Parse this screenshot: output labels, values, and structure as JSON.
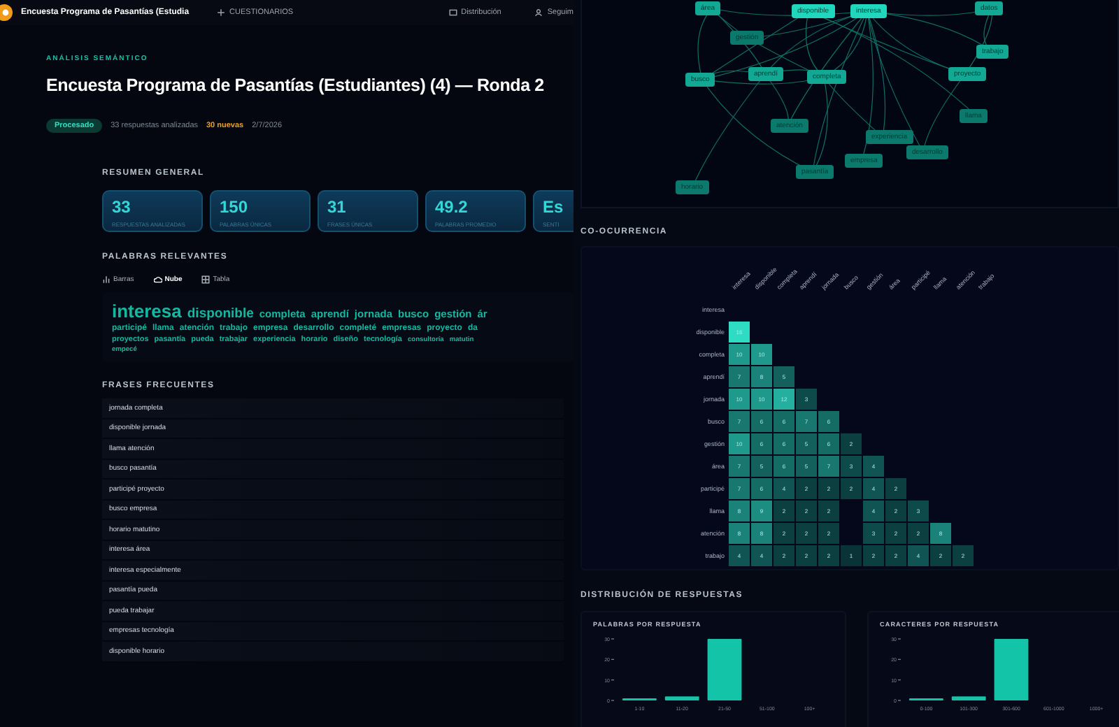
{
  "topbar": {
    "title": "Encuesta Programa de Pasantías (Estudia",
    "nav": [
      "CUESTIONARIOS",
      "Distribución",
      "Seguim"
    ]
  },
  "header": {
    "eyebrow": "ANÁLISIS SEMÁNTICO",
    "title": "Encuesta Programa de Pasantías (Estudiantes) (4) — Ronda 2",
    "status": "Procesado",
    "analyzed": "33 respuestas analizadas",
    "new": "30 nuevas",
    "date": "2/7/2026"
  },
  "summary": {
    "title": "RESUMEN GENERAL",
    "cards": [
      {
        "value": "33",
        "label": "RESPUESTAS ANALIZADAS"
      },
      {
        "value": "150",
        "label": "PALABRAS ÚNICAS"
      },
      {
        "value": "31",
        "label": "FRASES ÚNICAS"
      },
      {
        "value": "49.2",
        "label": "PALABRAS PROMEDIO"
      },
      {
        "value": "Es",
        "label": "SENTI"
      }
    ]
  },
  "keywords": {
    "title": "PALABRAS RELEVANTES",
    "tabs": [
      {
        "label": "Barras",
        "selected": false
      },
      {
        "label": "Nube",
        "selected": true
      },
      {
        "label": "Tabla",
        "selected": false
      }
    ],
    "cloud_lines": [
      [
        {
          "text": "interesa",
          "kind": "xl"
        },
        {
          "text": "disponible",
          "kind": "lg"
        },
        {
          "text": "completa",
          "kind": "md"
        },
        {
          "text": "aprendí",
          "kind": "md"
        },
        {
          "text": "jornada",
          "kind": "md"
        },
        {
          "text": "busco",
          "kind": "md"
        },
        {
          "text": "gestión",
          "kind": "md"
        },
        {
          "text": "ár",
          "kind": "md"
        }
      ],
      [
        {
          "text": "participé",
          "kind": "sm"
        },
        {
          "text": "llama",
          "kind": "sm"
        },
        {
          "text": "atención",
          "kind": "sm"
        },
        {
          "text": "trabajo",
          "kind": "sm"
        },
        {
          "text": "empresa",
          "kind": "sm"
        },
        {
          "text": "desarrollo",
          "kind": "sm"
        },
        {
          "text": "completé",
          "kind": "sm"
        },
        {
          "text": "empresas",
          "kind": "sm"
        },
        {
          "text": "proyecto",
          "kind": "sm"
        },
        {
          "text": "da",
          "kind": "sm"
        }
      ],
      [
        {
          "text": "proyectos",
          "kind": "xs"
        },
        {
          "text": "pasantía",
          "kind": "xs"
        },
        {
          "text": "pueda",
          "kind": "xs"
        },
        {
          "text": "trabajar",
          "kind": "xs"
        },
        {
          "text": "experiencia",
          "kind": "xs"
        },
        {
          "text": "horario",
          "kind": "xs"
        },
        {
          "text": "diseño",
          "kind": "xs"
        },
        {
          "text": "tecnología",
          "kind": "xs"
        },
        {
          "text": "consultoría",
          "kind": "xxs"
        },
        {
          "text": "matutin",
          "kind": "xxs"
        }
      ],
      [
        {
          "text": "empecé",
          "kind": "xxs"
        }
      ]
    ]
  },
  "phrases": {
    "title": "FRASES FRECUENTES",
    "items": [
      "jornada completa",
      "disponible jornada",
      "llama atención",
      "busco pasantía",
      "participé proyecto",
      "busco empresa",
      "horario matutino",
      "interesa área",
      "interesa especialmente",
      "pasantía pueda",
      "pueda trabajar",
      "empresas tecnología",
      "disponible horario"
    ]
  },
  "network": {
    "nodes": [
      {
        "label": "área",
        "kind": "mid"
      },
      {
        "label": "disponible",
        "kind": "hub"
      },
      {
        "label": "interesa",
        "kind": "hub"
      },
      {
        "label": "datos",
        "kind": "mid"
      },
      {
        "label": "gestión",
        "kind": "minor"
      },
      {
        "label": "trabajo",
        "kind": "mid"
      },
      {
        "label": "busco",
        "kind": "mid"
      },
      {
        "label": "aprendí",
        "kind": "mid"
      },
      {
        "label": "completa",
        "kind": "mid"
      },
      {
        "label": "proyecto",
        "kind": "mid"
      },
      {
        "label": "llama",
        "kind": "minor"
      },
      {
        "label": "atención",
        "kind": "minor"
      },
      {
        "label": "experiencia",
        "kind": "minor"
      },
      {
        "label": "desarrollo",
        "kind": "minor"
      },
      {
        "label": "empresa",
        "kind": "minor"
      },
      {
        "label": "pasantía",
        "kind": "minor"
      },
      {
        "label": "horario",
        "kind": "minor"
      }
    ]
  },
  "cooccurrence": {
    "title": "CO-OCURRENCIA",
    "columns": [
      "interesa",
      "disponible",
      "completa",
      "aprendí",
      "jornada",
      "busco",
      "gestión",
      "área",
      "participé",
      "llama",
      "atención",
      "trabajo"
    ],
    "rows": [
      {
        "label": "interesa",
        "cells": []
      },
      {
        "label": "disponible",
        "cells": [
          "16"
        ]
      },
      {
        "label": "completa",
        "cells": [
          "10",
          "10"
        ]
      },
      {
        "label": "aprendí",
        "cells": [
          "7",
          "8",
          "5"
        ]
      },
      {
        "label": "jornada",
        "cells": [
          "10",
          "10",
          "12",
          "3"
        ]
      },
      {
        "label": "busco",
        "cells": [
          "7",
          "6",
          "6",
          "7",
          "6"
        ]
      },
      {
        "label": "gestión",
        "cells": [
          "10",
          "6",
          "6",
          "5",
          "6",
          "2"
        ]
      },
      {
        "label": "área",
        "cells": [
          "7",
          "5",
          "6",
          "5",
          "7",
          "3",
          "4"
        ]
      },
      {
        "label": "participé",
        "cells": [
          "7",
          "6",
          "4",
          "2",
          "2",
          "2",
          "4",
          "2"
        ]
      },
      {
        "label": "llama",
        "cells": [
          "8",
          "9",
          "2",
          "2",
          "2",
          null,
          "4",
          "2",
          "3"
        ]
      },
      {
        "label": "atención",
        "cells": [
          "8",
          "8",
          "2",
          "2",
          "2",
          null,
          "3",
          "2",
          "2",
          "8"
        ]
      },
      {
        "label": "trabajo",
        "cells": [
          "4",
          "4",
          "2",
          "2",
          "2",
          "1",
          "2",
          "2",
          "4",
          "2",
          "2"
        ]
      }
    ]
  },
  "distribution": {
    "title": "DISTRIBUCIÓN DE RESPUESTAS",
    "charts": [
      {
        "chart_data": {
          "type": "bar",
          "title": "PALABRAS POR RESPUESTA",
          "categories": [
            "1-10",
            "11-20",
            "21-50",
            "51-100",
            "100+"
          ],
          "series": [
            {
              "color": "#14c4a8",
              "values": [
                1,
                2,
                30,
                0,
                0
              ]
            }
          ],
          "yticks": [
            0,
            10,
            20,
            30
          ],
          "ylim": [
            0,
            30
          ]
        }
      },
      {
        "chart_data": {
          "type": "bar",
          "title": "CARACTERES POR RESPUESTA",
          "categories": [
            "0-100",
            "101-300",
            "301-600",
            "601-1000",
            "1000+"
          ],
          "series": [
            {
              "color": "#14c4a8",
              "values": [
                1,
                2,
                30,
                0,
                0
              ]
            }
          ],
          "yticks": [
            0,
            10,
            20,
            30
          ],
          "ylim": [
            0,
            30
          ]
        }
      }
    ]
  }
}
